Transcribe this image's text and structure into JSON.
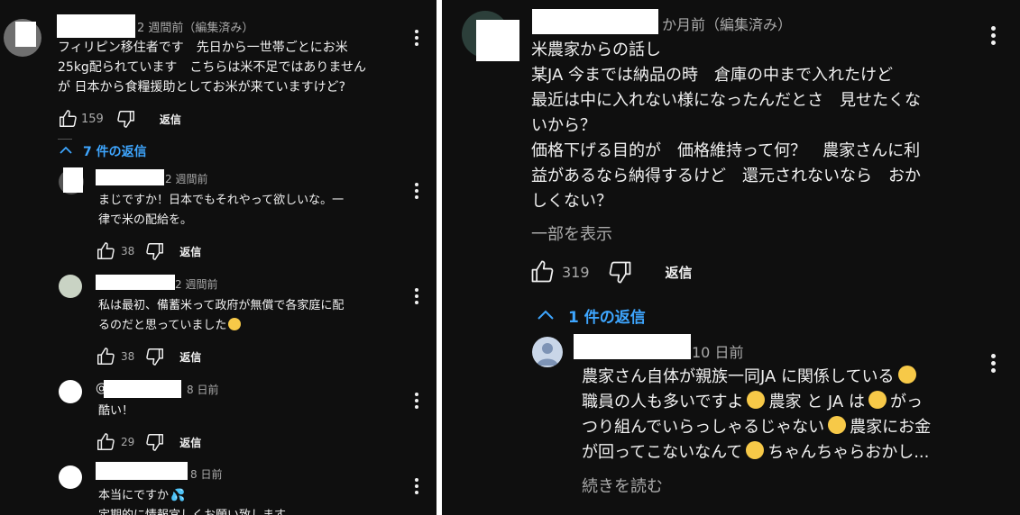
{
  "left": {
    "main": {
      "time": "2 週間前（編集済み）",
      "lines": [
        "フィリピン移住者です　先日から一世帯ごとにお米",
        "25kg配られています　こちらは米不足ではありません",
        "が 日本から食糧援助としてお米が来ていますけど?"
      ],
      "likes": "159",
      "reply_label": "返信"
    },
    "replies_toggle": "7 件の返信",
    "replies": [
      {
        "time": "2 週間前",
        "lines": [
          "まじですか！日本でもそれやって欲しいな。一",
          "律で米の配給を。"
        ],
        "likes": "38",
        "reply_label": "返信"
      },
      {
        "time": "2 週間前",
        "lines": [
          "私は最初、備蓄米って政府が無償で各家庭に配",
          "るのだと思っていました"
        ],
        "likes": "38",
        "reply_label": "返信"
      },
      {
        "handle_prefix": "@",
        "time": "8 日前",
        "lines": [
          "酷い！"
        ],
        "likes": "29",
        "reply_label": "返信"
      },
      {
        "time": "8 日前",
        "lines": [
          "本当にですか",
          "定期的に情報宜しくお願い致します"
        ]
      }
    ]
  },
  "right": {
    "main": {
      "time": "か月前（編集済み）",
      "lines": [
        "米農家からの話し",
        "某JA 今までは納品の時　倉庫の中まで入れたけど",
        "最近は中に入れない様になったんだとさ　見せたくな",
        "いから？",
        "価格下げる目的が　価格維持って何？　農家さんに利",
        "益があるなら納得するけど　還元されないなら　おか",
        "しくない？"
      ],
      "show_less": "一部を表示",
      "likes": "319",
      "reply_label": "返信"
    },
    "replies_toggle": "1 件の返信",
    "reply": {
      "time": "10 日前",
      "line1": "農家さん自体が親族一同JA に関係している",
      "line2a": "職員の人も多いですよ",
      "line2b": "農家 と JA は",
      "line2c": "がっ",
      "line3a": "つり組んでいらっしゃるじゃない",
      "line3b": "農家にお金",
      "line4a": "が回ってこないなんて",
      "line4b": "ちゃんちゃらおかし...",
      "read_more": "続きを読む"
    }
  },
  "colors": {
    "background": "#0f0f0f",
    "text": "#f1f1f1",
    "meta": "#aaaaaa",
    "link": "#3ea6ff",
    "redaction": "#ffffff"
  },
  "icons": [
    "thumb-up-icon",
    "thumb-down-icon",
    "more-vert-icon",
    "chevron-up-icon",
    "emoji-icon",
    "sweat-droplets-icon"
  ]
}
